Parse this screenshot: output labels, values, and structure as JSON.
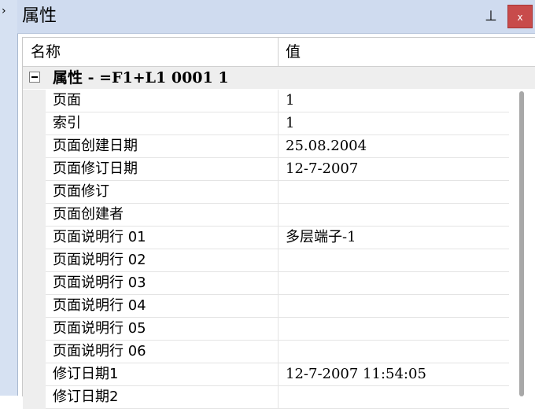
{
  "panel": {
    "title": "属性",
    "pin_glyph": "⊥",
    "close_glyph": "x"
  },
  "grid": {
    "header_name": "名称",
    "header_value": "值",
    "group_title": "属性 - =F1+L1 0001 1",
    "rows": [
      {
        "name": "页面",
        "value": "1"
      },
      {
        "name": "索引",
        "value": "1"
      },
      {
        "name": "页面创建日期",
        "value": "25.08.2004"
      },
      {
        "name": "页面修订日期",
        "value": "12-7-2007"
      },
      {
        "name": "页面修订",
        "value": ""
      },
      {
        "name": "页面创建者",
        "value": ""
      },
      {
        "name": "页面说明行 01",
        "value": "多层端子-1"
      },
      {
        "name": "页面说明行 02",
        "value": ""
      },
      {
        "name": "页面说明行 03",
        "value": ""
      },
      {
        "name": "页面说明行 04",
        "value": ""
      },
      {
        "name": "页面说明行 05",
        "value": ""
      },
      {
        "name": "页面说明行 06",
        "value": ""
      },
      {
        "name": "修订日期1",
        "value": "12-7-2007 11:54:05"
      },
      {
        "name": "修订日期2",
        "value": ""
      }
    ]
  },
  "colors": {
    "titlebar": "#cfdbef",
    "close_button": "#c84b4b",
    "gutter": "#eeeeee"
  }
}
